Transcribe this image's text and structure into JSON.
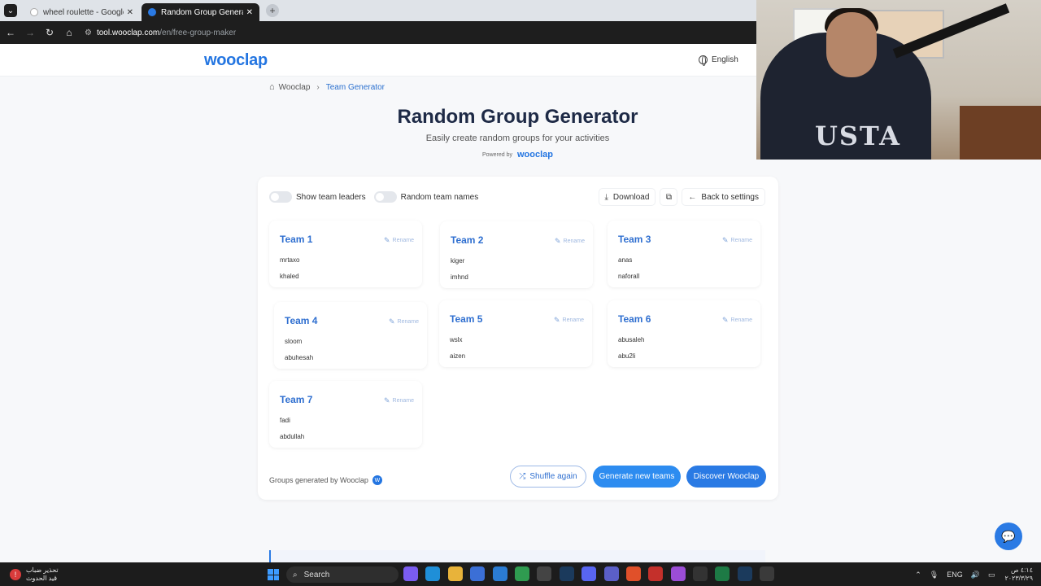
{
  "browser": {
    "tabs": [
      {
        "label": "wheel roulette - Google Search",
        "favicon_color": "#ffffff",
        "active": false
      },
      {
        "label": "Random Group Generator – Fre",
        "favicon_color": "#2a7ae4",
        "active": true
      }
    ],
    "url_host": "tool.wooclap.com",
    "url_path": "/en/free-group-maker"
  },
  "header": {
    "logo": "wooclap",
    "language": "English"
  },
  "breadcrumb": {
    "home": "Wooclap",
    "current": "Team Generator"
  },
  "hero": {
    "title": "Random Group Generator",
    "subtitle": "Easily create random groups for your activities",
    "powered_by": "Powered by",
    "powered_logo": "wooclap"
  },
  "controls": {
    "show_leaders": "Show team leaders",
    "random_names": "Random team names",
    "download": "Download",
    "back": "Back to settings"
  },
  "teams": [
    {
      "name": "Team 1",
      "rename": "Rename",
      "members": [
        "mrtaxo",
        "khaled"
      ]
    },
    {
      "name": "Team 2",
      "rename": "Rename",
      "members": [
        "kiger",
        "imhnd"
      ]
    },
    {
      "name": "Team 3",
      "rename": "Rename",
      "members": [
        "anas",
        "naforall"
      ]
    },
    {
      "name": "Team 4",
      "rename": "Rename",
      "members": [
        "sloom",
        "abuhesah"
      ]
    },
    {
      "name": "Team 5",
      "rename": "Rename",
      "members": [
        "wslx",
        "aizen"
      ]
    },
    {
      "name": "Team 6",
      "rename": "Rename",
      "members": [
        "abusaleh",
        "abu2li"
      ]
    },
    {
      "name": "Team 7",
      "rename": "Rename",
      "members": [
        "fadi",
        "abdullah"
      ]
    }
  ],
  "footer": {
    "generated_by": "Groups generated by Wooclap",
    "badge": "W",
    "shuffle": "Shuffle again",
    "generate": "Generate new teams",
    "discover": "Discover Wooclap"
  },
  "webcam": {
    "shirt_text": "USTA"
  },
  "taskbar": {
    "weather_line1": "تحذير ضباب",
    "weather_line2": "قيد الحدوث",
    "search": "Search",
    "lang": "ENG",
    "time": "٤:١٤ ص",
    "date": "٢٠٢٣/٣/٢٩",
    "apps": [
      {
        "icon": "copilot-icon",
        "color": "#7a5cf0"
      },
      {
        "icon": "edge-icon",
        "color": "#1f8fd8"
      },
      {
        "icon": "folder-icon",
        "color": "#e8b33a"
      },
      {
        "icon": "store-icon",
        "color": "#3b6fd6"
      },
      {
        "icon": "mail-icon",
        "color": "#2b7cd3"
      },
      {
        "icon": "chrome-icon",
        "color": "#2f9b50"
      },
      {
        "icon": "obs-icon",
        "color": "#444444"
      },
      {
        "icon": "steam-icon",
        "color": "#1b3a5c"
      },
      {
        "icon": "discord-icon",
        "color": "#5865f2"
      },
      {
        "icon": "teams-icon",
        "color": "#5b5fc7"
      },
      {
        "icon": "brave-icon",
        "color": "#e0502a"
      },
      {
        "icon": "acrobat-icon",
        "color": "#c4302b"
      },
      {
        "icon": "podcast-icon",
        "color": "#9b4dd6"
      },
      {
        "icon": "next-icon",
        "color": "#333333"
      },
      {
        "icon": "excel-icon",
        "color": "#1d7a45"
      },
      {
        "icon": "steam2-icon",
        "color": "#1b3a5c"
      },
      {
        "icon": "game-icon",
        "color": "#3a3a3a"
      }
    ]
  }
}
